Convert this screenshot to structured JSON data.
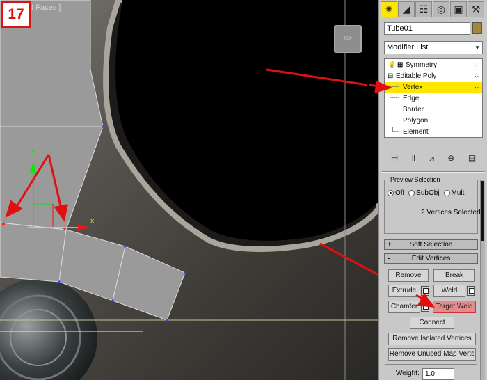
{
  "step_number": "17",
  "viewport": {
    "label": "ed Faces ]",
    "viewcube_text": "TOP",
    "axis_x": "x",
    "axis_y": "y"
  },
  "command_panel": {
    "tabs": [
      {
        "icon": "create-icon",
        "glyph": "✷"
      },
      {
        "icon": "modify-icon",
        "glyph": "◢"
      },
      {
        "icon": "hierarchy-icon",
        "glyph": "☷"
      },
      {
        "icon": "motion-icon",
        "glyph": "◎"
      },
      {
        "icon": "display-icon",
        "glyph": "▣"
      },
      {
        "icon": "utilities-icon",
        "glyph": "⚒"
      }
    ],
    "object_name": "Tube01",
    "object_color": "#a08a3a",
    "modifier_list_label": "Modifier List",
    "stack": [
      {
        "label": "Symmetry",
        "prefix": "💡 ⊞"
      },
      {
        "label": "Editable Poly",
        "prefix": "⊟"
      },
      {
        "label": "Vertex",
        "prefix": "┈┈"
      },
      {
        "label": "Edge",
        "prefix": "┈┈"
      },
      {
        "label": "Border",
        "prefix": "┈┈"
      },
      {
        "label": "Polygon",
        "prefix": "┈┈"
      },
      {
        "label": "Element",
        "prefix": "└┈"
      }
    ],
    "selected_stack_item": "Vertex",
    "selection_color": "#ffe600",
    "stack_tool_icons": [
      "pin-stack-icon",
      "show-end-result-icon",
      "make-unique-icon",
      "remove-modifier-icon",
      "configure-sets-icon"
    ],
    "preview_selection": {
      "title": "Preview Selection",
      "options": [
        "Off",
        "SubObj",
        "Multi"
      ],
      "selected": "Off"
    },
    "selection_status": "2 Vertices Selected",
    "soft_selection_label": "Soft Selection",
    "edit_vertices_label": "Edit Vertices",
    "buttons": {
      "remove": "Remove",
      "break": "Break",
      "extrude": "Extrude",
      "weld": "Weld",
      "chamfer": "Chamfer",
      "target_weld": "Target Weld",
      "connect": "Connect",
      "remove_isolated": "Remove Isolated Vertices",
      "remove_unused": "Remove Unused Map Verts"
    },
    "weight_label": "Weight:",
    "weight_value": "1.0",
    "highlight_color": "#e38c8c"
  },
  "annotation_color": "#e01010"
}
